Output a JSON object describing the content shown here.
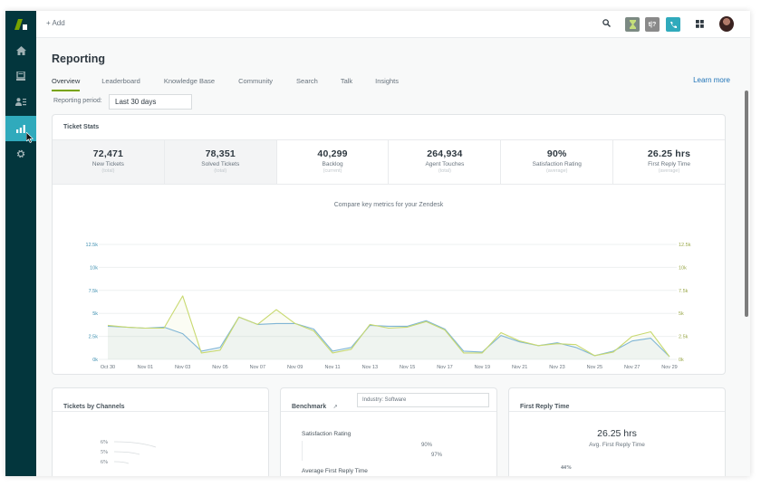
{
  "sidebar": {
    "items": [
      {
        "name": "home",
        "icon": "home-icon"
      },
      {
        "name": "views",
        "icon": "inbox-icon"
      },
      {
        "name": "customers",
        "icon": "user-list-icon"
      },
      {
        "name": "reporting",
        "icon": "bar-chart-icon",
        "active": true
      },
      {
        "name": "admin",
        "icon": "gear-icon"
      }
    ],
    "accent": "#30aabc",
    "background": "#03363d"
  },
  "topbar": {
    "add_label": "+ Add",
    "apps": [
      {
        "name": "timer",
        "color": "#7c8a83",
        "glyph": "⧗"
      },
      {
        "name": "legacy-app",
        "color": "#8a8a8a",
        "glyph": "t"
      },
      {
        "name": "talk",
        "color": "#30aabc",
        "glyph": "✆"
      }
    ]
  },
  "header": {
    "title": "Reporting",
    "learn_more": "Learn more"
  },
  "tabs": [
    {
      "label": "Overview",
      "active": true
    },
    {
      "label": "Leaderboard"
    },
    {
      "label": "Knowledge Base"
    },
    {
      "label": "Community"
    },
    {
      "label": "Search"
    },
    {
      "label": "Talk"
    },
    {
      "label": "Insights"
    }
  ],
  "period": {
    "label": "Reporting period:",
    "value": "Last 30 days"
  },
  "ticket_stats": {
    "title": "Ticket Stats",
    "stats": [
      {
        "value": "72,471",
        "label": "New Tickets",
        "sub": "(total)"
      },
      {
        "value": "78,351",
        "label": "Solved Tickets",
        "sub": "(total)"
      },
      {
        "value": "40,299",
        "label": "Backlog",
        "sub": "(current)"
      },
      {
        "value": "264,934",
        "label": "Agent Touches",
        "sub": "(total)"
      },
      {
        "value": "90%",
        "label": "Satisfaction Rating",
        "sub": "(average)"
      },
      {
        "value": "26.25 hrs",
        "label": "First Reply Time",
        "sub": "(average)"
      }
    ]
  },
  "chart_data": {
    "type": "line",
    "title": "Compare key metrics for your Zendesk",
    "xlabel": "",
    "ylabel": "",
    "ylim": [
      0,
      12500
    ],
    "y_ticks": [
      "0k",
      "2.5k",
      "5k",
      "7.5k",
      "10k",
      "12.5k"
    ],
    "x": [
      "Oct 30",
      "Oct 31",
      "Nov 01",
      "Nov 02",
      "Nov 03",
      "Nov 04",
      "Nov 05",
      "Nov 06",
      "Nov 07",
      "Nov 08",
      "Nov 09",
      "Nov 10",
      "Nov 11",
      "Nov 12",
      "Nov 13",
      "Nov 14",
      "Nov 15",
      "Nov 16",
      "Nov 17",
      "Nov 18",
      "Nov 19",
      "Nov 20",
      "Nov 21",
      "Nov 22",
      "Nov 23",
      "Nov 24",
      "Nov 25",
      "Nov 26",
      "Nov 27",
      "Nov 28",
      "Nov 29"
    ],
    "x_tick_labels": [
      "Oct 30",
      "Nov 01",
      "Nov 03",
      "Nov 05",
      "Nov 07",
      "Nov 09",
      "Nov 11",
      "Nov 13",
      "Nov 15",
      "Nov 17",
      "Nov 19",
      "Nov 21",
      "Nov 23",
      "Nov 25",
      "Nov 27",
      "Nov 29"
    ],
    "grid": true,
    "series": [
      {
        "name": "Solved Tickets",
        "color": "#7fb5d5",
        "values": [
          3600,
          3500,
          3400,
          3500,
          2800,
          900,
          1300,
          4600,
          3800,
          3900,
          3900,
          3300,
          900,
          1300,
          3700,
          3600,
          3600,
          4200,
          3300,
          900,
          800,
          2600,
          1900,
          1500,
          1800,
          1300,
          400,
          900,
          2000,
          2300,
          300
        ]
      },
      {
        "name": "New Tickets",
        "color": "#c8d96f",
        "values": [
          3700,
          3500,
          3400,
          3400,
          6900,
          700,
          1000,
          4600,
          3800,
          5400,
          3900,
          3100,
          700,
          1100,
          3800,
          3400,
          3500,
          4100,
          3200,
          700,
          700,
          2900,
          2000,
          1500,
          1700,
          1600,
          400,
          800,
          2500,
          3000,
          300
        ]
      }
    ]
  },
  "channels": {
    "title": "Tickets by Channels",
    "labels": [
      "6%",
      "5%",
      "6%"
    ]
  },
  "benchmark": {
    "title": "Benchmark",
    "industry": "Industry: Software",
    "metric1": "Satisfaction Rating",
    "metric1_values": [
      "90%",
      "97%"
    ],
    "metric2": "Average First Reply Time"
  },
  "first_reply": {
    "title": "First Reply Time",
    "value": "26.25 hrs",
    "sub": "Avg. First Reply Time",
    "pct": "44%"
  }
}
